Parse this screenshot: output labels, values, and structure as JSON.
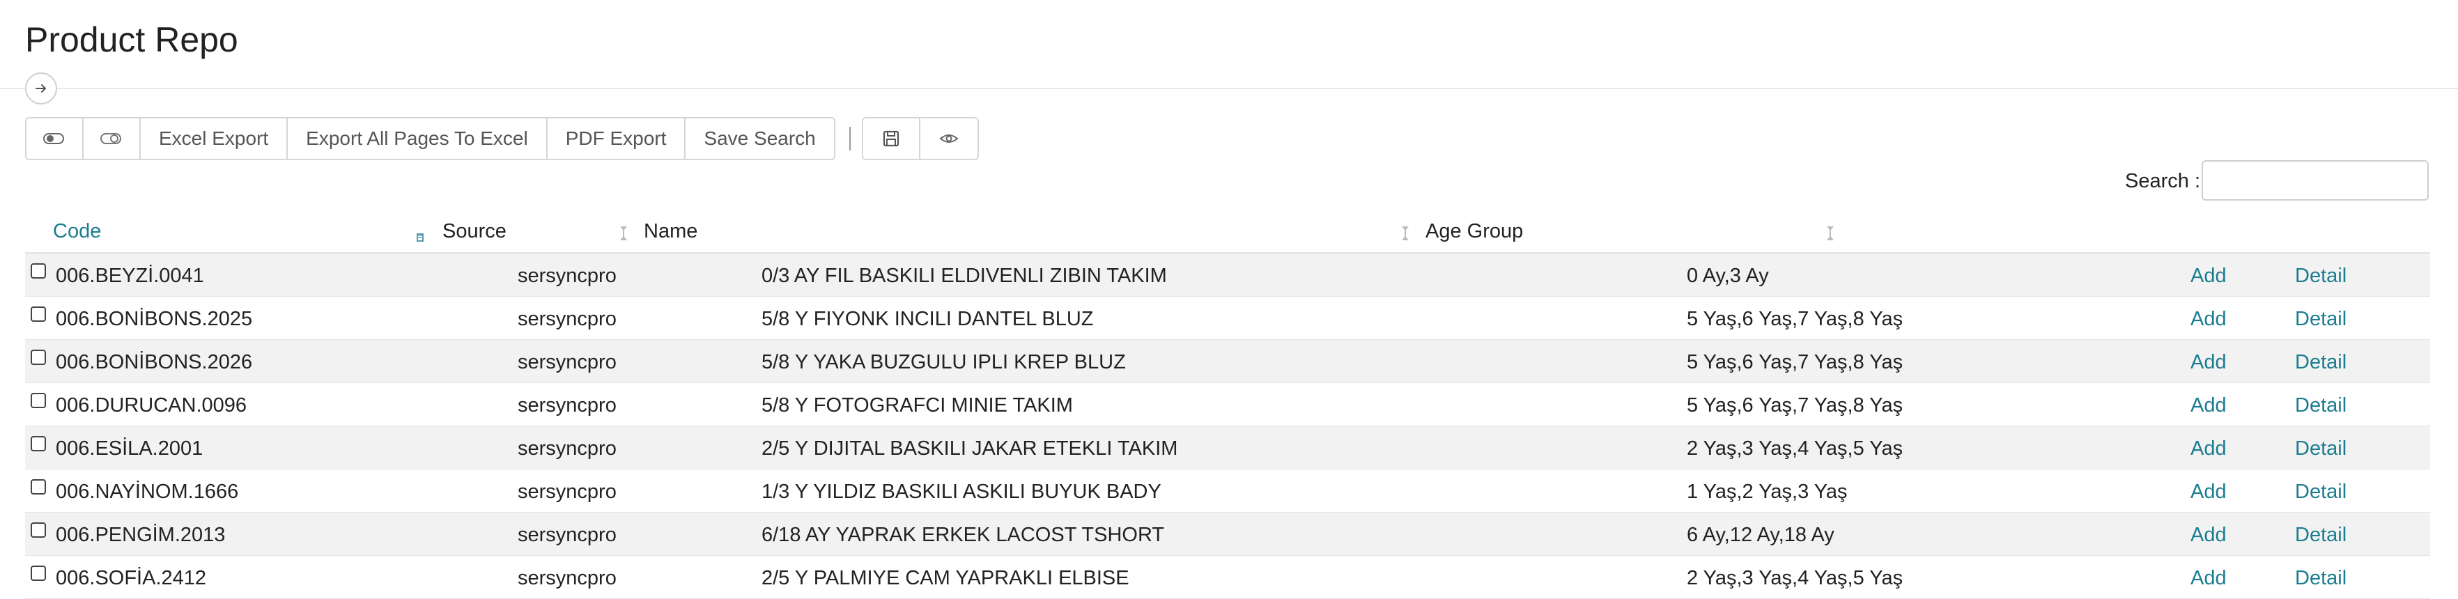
{
  "page": {
    "title": "Product Repo"
  },
  "toolbar": {
    "toggle_on_icon": "toggle-on-icon",
    "toggle_off_icon": "toggle-off-icon",
    "excel_export": "Excel Export",
    "export_all": "Export All Pages To Excel",
    "pdf_export": "PDF Export",
    "save_search": "Save Search",
    "save_icon": "floppy-disk-icon",
    "view_icon": "eye-icon"
  },
  "search": {
    "label": "Search :",
    "value": ""
  },
  "table": {
    "columns": [
      "Code",
      "Source",
      "Name",
      "Age Group"
    ],
    "rows": [
      {
        "code": "006.BEYZİ.0041",
        "source": "sersyncpro",
        "name": "0/3 AY FIL BASKILI ELDIVENLI ZIBIN TAKIM",
        "age": "0 Ay,3 Ay",
        "add": "Add",
        "detail": "Detail"
      },
      {
        "code": "006.BONİBONS.2025",
        "source": "sersyncpro",
        "name": "5/8 Y FIYONK INCILI DANTEL BLUZ",
        "age": "5 Yaş,6 Yaş,7 Yaş,8 Yaş",
        "add": "Add",
        "detail": "Detail"
      },
      {
        "code": "006.BONİBONS.2026",
        "source": "sersyncpro",
        "name": "5/8 Y YAKA BUZGULU IPLI KREP BLUZ",
        "age": "5 Yaş,6 Yaş,7 Yaş,8 Yaş",
        "add": "Add",
        "detail": "Detail"
      },
      {
        "code": "006.DURUCAN.0096",
        "source": "sersyncpro",
        "name": "5/8 Y FOTOGRAFCI MINIE TAKIM",
        "age": "5 Yaş,6 Yaş,7 Yaş,8 Yaş",
        "add": "Add",
        "detail": "Detail"
      },
      {
        "code": "006.ESİLA.2001",
        "source": "sersyncpro",
        "name": "2/5 Y DIJITAL BASKILI JAKAR ETEKLI TAKIM",
        "age": "2 Yaş,3 Yaş,4 Yaş,5 Yaş",
        "add": "Add",
        "detail": "Detail"
      },
      {
        "code": "006.NAYİNOM.1666",
        "source": "sersyncpro",
        "name": "1/3 Y YILDIZ BASKILI ASKILI BUYUK BADY",
        "age": "1 Yaş,2 Yaş,3 Yaş",
        "add": "Add",
        "detail": "Detail"
      },
      {
        "code": "006.PENGİM.2013",
        "source": "sersyncpro",
        "name": "6/18 AY YAPRAK ERKEK LACOST TSHORT",
        "age": "6 Ay,12 Ay,18 Ay",
        "add": "Add",
        "detail": "Detail"
      },
      {
        "code": "006.SOFİA.2412",
        "source": "sersyncpro",
        "name": "2/5 Y PALMIYE CAM YAPRAKLI ELBISE",
        "age": "2 Yaş,3 Yaş,4 Yaş,5 Yaş",
        "add": "Add",
        "detail": "Detail"
      }
    ]
  },
  "colors": {
    "link": "#1a7d8f",
    "striped_row": "#f2f2f2"
  }
}
